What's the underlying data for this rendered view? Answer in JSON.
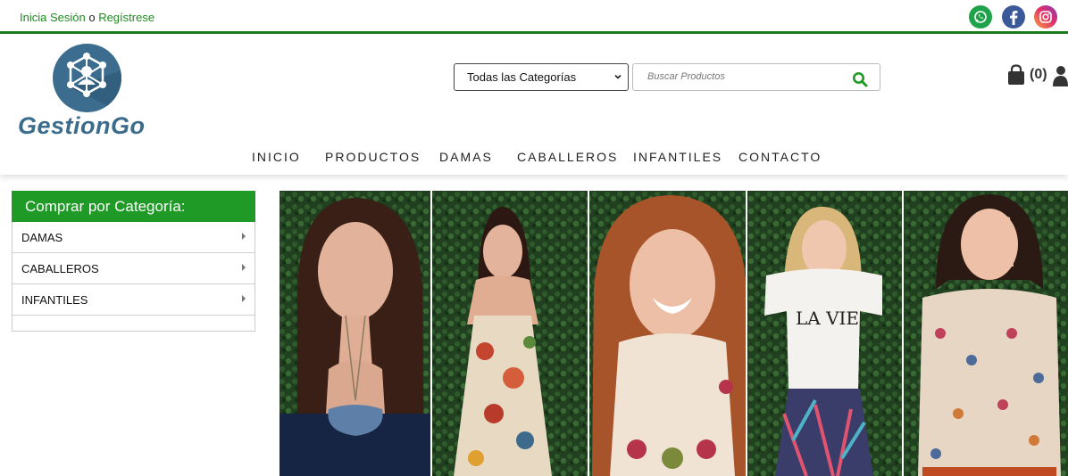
{
  "topbar": {
    "login_label": "Inicia Sesión",
    "connector": " o ",
    "register_label": "Regístrese",
    "social": [
      "whatsapp-icon",
      "facebook-icon",
      "instagram-icon"
    ]
  },
  "brand": {
    "name": "GestionGo",
    "color": "#3b6c8c"
  },
  "search": {
    "category_selected": "Todas las Categorías",
    "placeholder": "Buscar Productos"
  },
  "cart": {
    "count_label": "(0)"
  },
  "nav": {
    "items": [
      "INICIO",
      "PRODUCTOS",
      "DAMAS",
      "CABALLEROS",
      "INFANTILES",
      "CONTACTO"
    ]
  },
  "sidebar": {
    "title": "Comprar por Categoría:",
    "items": [
      "DAMAS",
      "CABALLEROS",
      "INFANTILES"
    ]
  },
  "colors": {
    "accent_green": "#1f9a26",
    "link_green": "#1e8a1e",
    "nav_border": "#1b7a1b"
  }
}
